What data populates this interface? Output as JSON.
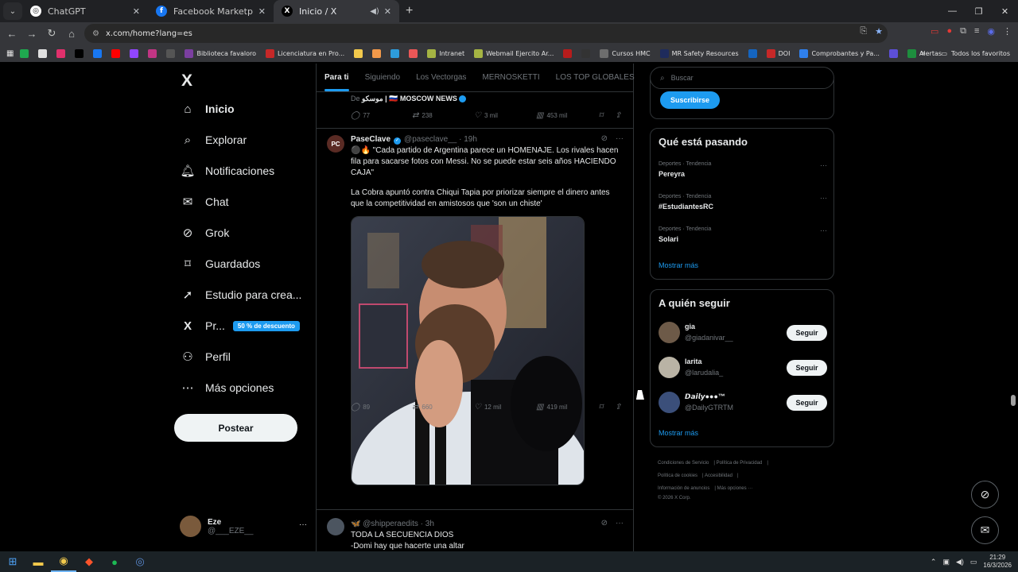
{
  "browser": {
    "tabs": [
      {
        "title": "ChatGPT",
        "fav": "◎",
        "favColor": "#ffffff",
        "favText": "#202124"
      },
      {
        "title": "Facebook Marketplace | Facebo",
        "fav": "f",
        "favColor": "#1877f2",
        "favText": "#ffffff"
      },
      {
        "title": "Inicio / X",
        "fav": "X",
        "favColor": "#000000",
        "favText": "#ffffff"
      }
    ],
    "url": "x.com/home?lang=es",
    "new_tab": "+",
    "bookmarks": [
      {
        "label": "",
        "color": "#1fa84f"
      },
      {
        "label": "",
        "color": "#e0e0e0"
      },
      {
        "label": "",
        "color": "#e1306c"
      },
      {
        "label": "",
        "color": "#000000"
      },
      {
        "label": "",
        "color": "#1877f2"
      },
      {
        "label": "",
        "color": "#ff0000"
      },
      {
        "label": "",
        "color": "#9146ff"
      },
      {
        "label": "",
        "color": "#c13584"
      },
      {
        "label": "",
        "color": "#555555"
      },
      {
        "label": "Biblioteca favaloro",
        "color": "#7b3fa0"
      },
      {
        "label": "Licenciatura en Pro...",
        "color": "#c62828"
      },
      {
        "label": "",
        "color": "#f2c94c"
      },
      {
        "label": "",
        "color": "#f2994a"
      },
      {
        "label": "",
        "color": "#2d9cdb"
      },
      {
        "label": "",
        "color": "#eb5757"
      },
      {
        "label": "Intranet",
        "color": "#a5b443"
      },
      {
        "label": "Webmail Ejercito Ar...",
        "color": "#a5b443"
      },
      {
        "label": "",
        "color": "#b71c1c"
      },
      {
        "label": "",
        "color": "#333333"
      },
      {
        "label": "Cursos HMC",
        "color": "#6d6d6d"
      },
      {
        "label": "MR Safety Resources",
        "color": "#1e2b5c"
      },
      {
        "label": "",
        "color": "#1565c0"
      },
      {
        "label": "DOI",
        "color": "#c62828"
      },
      {
        "label": "Comprobantes y Pa...",
        "color": "#2f80ed"
      },
      {
        "label": "",
        "color": "#5d4fd8"
      },
      {
        "label": "Alertas",
        "color": "#1e8e3e"
      }
    ],
    "bookmarks_all": "Todos los favoritos"
  },
  "nav": {
    "logo": "X",
    "items": [
      {
        "label": "Inicio",
        "icon": "home-icon",
        "glyph": "⌂"
      },
      {
        "label": "Explorar",
        "icon": "search-icon",
        "glyph": "⌕"
      },
      {
        "label": "Notificaciones",
        "icon": "bell-icon",
        "glyph": "🔔︎"
      },
      {
        "label": "Chat",
        "icon": "mail-icon",
        "glyph": "✉"
      },
      {
        "label": "Grok",
        "icon": "grok-icon",
        "glyph": "⊘"
      },
      {
        "label": "Guardados",
        "icon": "bookmark-icon",
        "glyph": "⌑"
      },
      {
        "label": "Estudio para crea...",
        "icon": "rocket-icon",
        "glyph": "➚"
      },
      {
        "label": "Pr...",
        "icon": "premium-x-icon",
        "glyph": "X"
      },
      {
        "label": "Perfil",
        "icon": "profile-icon",
        "glyph": "⚇"
      },
      {
        "label": "Más opciones",
        "icon": "more-icon",
        "glyph": "⋯"
      }
    ],
    "promo_badge": "50 % de descuento",
    "post_button": "Postear",
    "account": {
      "name": "Eze",
      "handle": "@___EZE__",
      "more": "···"
    }
  },
  "feed": {
    "tabs": [
      "Para ti",
      "Siguiendo",
      "Los Vectorgas",
      "MERNOSKETTI",
      "LOS TOP GLOBALES"
    ],
    "prev": {
      "source_prefix": "De",
      "source": "موسكو | 🇷🇺 MOSCOW NEWS",
      "replies": "77",
      "reposts": "238",
      "likes": "3 mil",
      "views": "453 mil"
    },
    "tweet": {
      "avatar": "PC",
      "name": "PaseClave",
      "handle": "@paseclave__",
      "time": "· 19h",
      "text1": "⚫🔥 \"Cada partido de Argentina parece un HOMENAJE. Los rivales hacen fila para sacarse fotos con Messi. No se puede estar seis años HACIENDO CAJA\"",
      "text2": "La Cobra apuntó contra Chiqui Tapia por priorizar siempre el dinero antes que la competitividad en amistosos que 'son un chiste'",
      "replies": "89",
      "reposts": "660",
      "likes": "12 mil",
      "views": "419 mil"
    },
    "next": {
      "handle": "🦋 @shipperaedits",
      "time": "· 3h",
      "line1": "TODA LA SECUENCIA DIOS",
      "line2": "-Domi hay que hacerte una altar"
    }
  },
  "sidebar": {
    "search_placeholder": "Buscar",
    "subscribe": "Suscribirse",
    "trending_title": "Qué está pasando",
    "trends": [
      {
        "cat": "Deportes · Tendencia",
        "name": "Pereyra"
      },
      {
        "cat": "Deportes · Tendencia",
        "name": "#EstudiantesRC"
      },
      {
        "cat": "Deportes · Tendencia",
        "name": "Solari"
      }
    ],
    "show_more": "Mostrar más",
    "follow_title": "A quién seguir",
    "follows": [
      {
        "name": "gia",
        "handle": "@giadanivar__",
        "btn": "Seguir",
        "color": "#6d5a48"
      },
      {
        "name": "larita",
        "handle": "@larudalia_",
        "btn": "Seguir",
        "color": "#b9b3a5"
      },
      {
        "name": "𝘿𝙖𝙞𝙡𝙮●●●™",
        "handle": "@DailyGTRTM",
        "btn": "Seguir",
        "color": "#3b4f7a"
      }
    ],
    "show_more2": "Mostrar más",
    "footer": [
      "Condiciones de Servicio",
      "Política de Privacidad",
      "Política de cookies",
      "Accesibilidad",
      "Información de anuncios",
      "Más opciones ···",
      "© 2026 X Corp."
    ]
  },
  "taskbar": {
    "time": "21:29",
    "date": "16/3/2026"
  }
}
